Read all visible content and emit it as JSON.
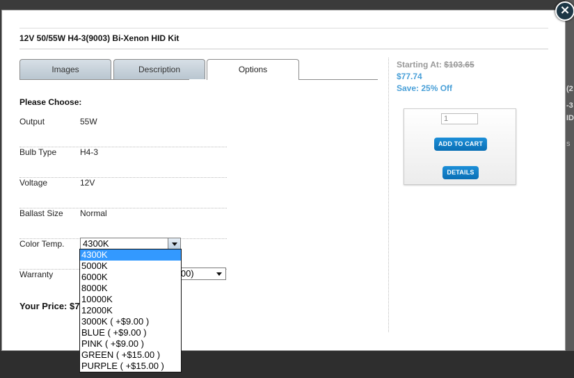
{
  "modal": {
    "title": "12V 50/55W H4-3(9003) Bi-Xenon HID Kit",
    "close_glyph": "×"
  },
  "background_fragments": [
    "(2",
    "-3",
    "ID",
    "s"
  ],
  "tabs": [
    {
      "label": "Images",
      "active": false
    },
    {
      "label": "Description",
      "active": false
    },
    {
      "label": "Options",
      "active": true
    }
  ],
  "options": {
    "heading": "Please Choose:",
    "rows": [
      {
        "label": "Output",
        "value": "55W"
      },
      {
        "label": "Bulb Type",
        "value": "H4-3"
      },
      {
        "label": "Voltage",
        "value": "12V"
      },
      {
        "label": "Ballast Size",
        "value": "Normal"
      }
    ],
    "color_temp": {
      "label": "Color Temp.",
      "selected": "4300K",
      "choices": [
        "4300K",
        "5000K",
        "6000K",
        "8000K",
        "10000K",
        "12000K",
        "3000K ( +$9.00 )",
        "BLUE ( +$9.00 )",
        "PINK ( +$9.00 )",
        "GREEN ( +$15.00 )",
        "PURPLE ( +$15.00 )"
      ]
    },
    "warranty": {
      "label": "Warranty",
      "visible_value": "0.00)"
    },
    "price_label": "Your Price: $7"
  },
  "pricing": {
    "starting_label": "Starting At:",
    "old_price": "$103.65",
    "sale_price": "$77.74",
    "save_text": "Save: 25% Off"
  },
  "cart": {
    "qty_value": "1",
    "add_to_cart_label": "ADD TO CART",
    "details_label": "DETAILS"
  },
  "colors": {
    "accent_blue": "#0a6fb5",
    "price_blue": "#4aa0d8",
    "selection_blue": "#3399ff",
    "close_button": "#1d3746"
  }
}
